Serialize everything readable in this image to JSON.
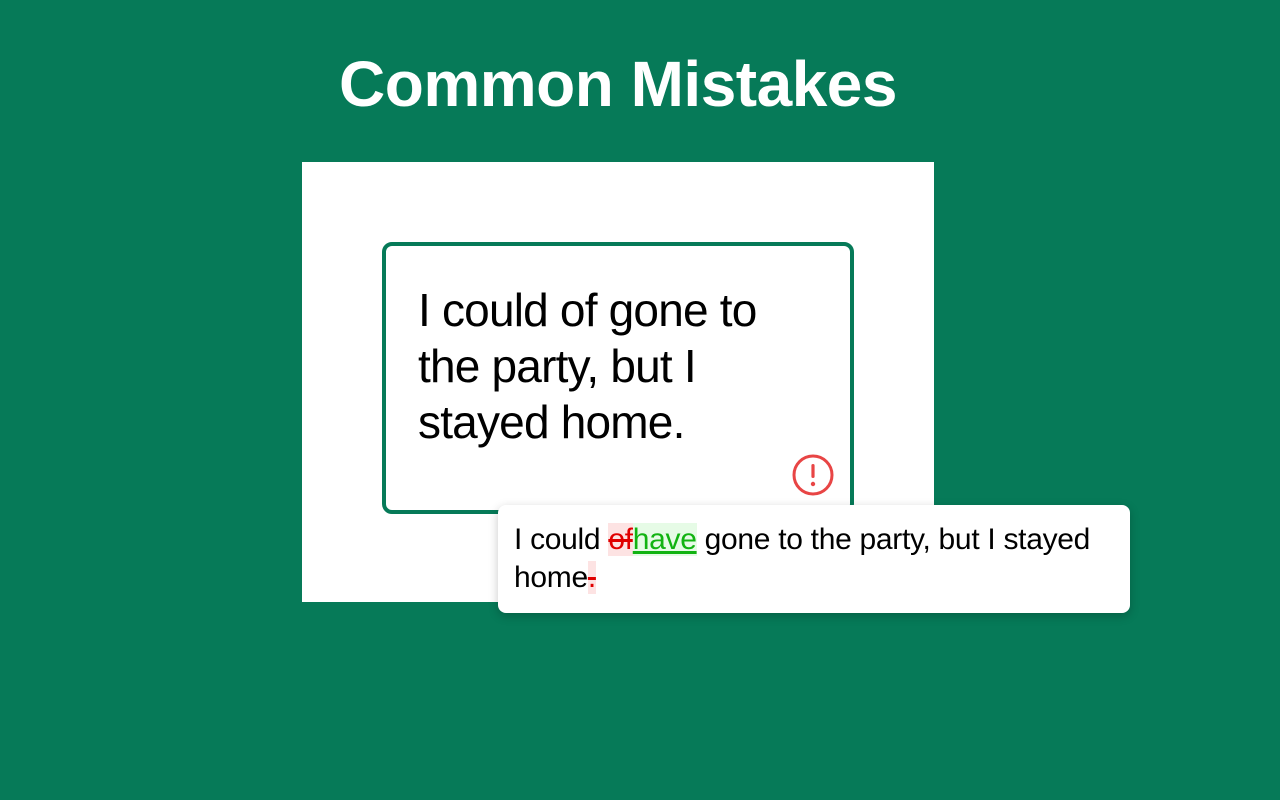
{
  "page": {
    "title": "Common Mistakes"
  },
  "editor": {
    "text": "I could of gone to the party, but I stayed home."
  },
  "suggestion": {
    "before_1": "I could ",
    "deleted_1": "of",
    "inserted_1": "have",
    "middle": " gone to the party, but I stayed home",
    "deleted_2": "."
  },
  "icons": {
    "error": "exclamation-circle-icon"
  },
  "colors": {
    "background": "#067a58",
    "accent": "#067a58",
    "error": "#e84545",
    "deletion": "#e00000",
    "insertion": "#12b312"
  }
}
